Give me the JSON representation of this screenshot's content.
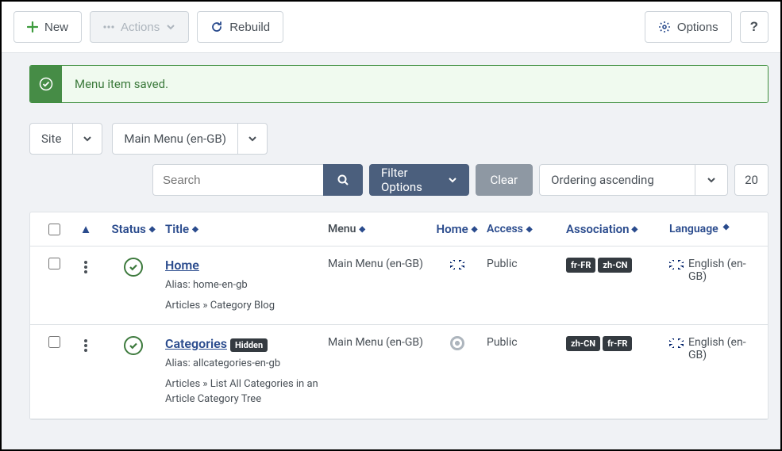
{
  "toolbar": {
    "new": "New",
    "actions": "Actions",
    "rebuild": "Rebuild",
    "options": "Options"
  },
  "alert": {
    "message": "Menu item saved."
  },
  "filters": {
    "client": "Site",
    "menu": "Main Menu (en-GB)",
    "search_placeholder": "Search",
    "filter_options": "Filter Options",
    "clear": "Clear",
    "ordering": "Ordering ascending",
    "limit": "20"
  },
  "columns": {
    "status": "Status",
    "title": "Title",
    "menu": "Menu",
    "home": "Home",
    "access": "Access",
    "association": "Association",
    "language": "Language"
  },
  "rows": [
    {
      "title": "Home",
      "hidden": false,
      "alias": "Alias: home-en-gb",
      "type": "Articles » Category Blog",
      "menu": "Main Menu (en-GB)",
      "home_flag": "gb",
      "access": "Public",
      "assoc": [
        "fr-FR",
        "zh-CN"
      ],
      "language": "English (en-GB)"
    },
    {
      "title": "Categories",
      "hidden": true,
      "hidden_label": "Hidden",
      "alias": "Alias: allcategories-en-gb",
      "type": "Articles » List All Categories in an Article Category Tree",
      "menu": "Main Menu (en-GB)",
      "home_flag": "",
      "access": "Public",
      "assoc": [
        "zh-CN",
        "fr-FR"
      ],
      "language": "English (en-GB)"
    }
  ]
}
